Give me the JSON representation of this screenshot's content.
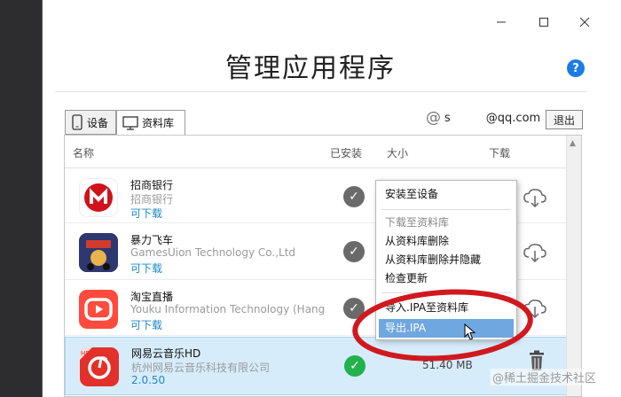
{
  "window": {
    "minimize_icon": "minimize-icon",
    "maximize_icon": "maximize-icon",
    "close_icon": "close-icon"
  },
  "title": "管理应用程序",
  "help_label": "?",
  "tabs": [
    {
      "label": "设备",
      "icon": "phone-icon"
    },
    {
      "label": "资料库",
      "icon": "monitor-icon",
      "active": true
    }
  ],
  "account": {
    "at_symbol": "@",
    "user_start": "s",
    "user_end": "@qq.com"
  },
  "logout_label": "退出",
  "table": {
    "headers": {
      "name": "名称",
      "installed": "已安装",
      "size": "大小",
      "download": "下载"
    },
    "rows": [
      {
        "name": "招商银行",
        "developer": "招商银行",
        "status": "可下载",
        "installed_state": "grey"
      },
      {
        "name": "暴力飞车",
        "developer": "GamesUion Technology Co.,Ltd",
        "status": "可下载",
        "installed_state": "grey"
      },
      {
        "name": "淘宝直播",
        "developer": "Youku Information Technology (Hang",
        "status": "可下载",
        "installed_state": "grey"
      },
      {
        "name": "网易云音乐HD",
        "developer": "杭州网易云音乐科技有限公司",
        "status": "2.0.50",
        "installed_state": "green",
        "size": "51.40 MB",
        "selected": true
      }
    ]
  },
  "context_menu": [
    {
      "label": "安装至设备"
    },
    {
      "label": "下载至资料库",
      "disabled": true
    },
    {
      "label": "从资料库删除"
    },
    {
      "label": "从资料库删除并隐藏"
    },
    {
      "label": "检查更新"
    },
    {
      "label": "导入.IPA至资料库"
    },
    {
      "label": "导出.IPA",
      "hover": true
    }
  ],
  "watermark": "@稀土掘金技术社区",
  "colors": {
    "accent": "#1c7ce4",
    "link": "#1e88c7",
    "selected_row": "#d7ecfb",
    "menu_hover": "#6fa7e0",
    "annotation_red": "#d0191f",
    "installed_green": "#22b14c"
  }
}
